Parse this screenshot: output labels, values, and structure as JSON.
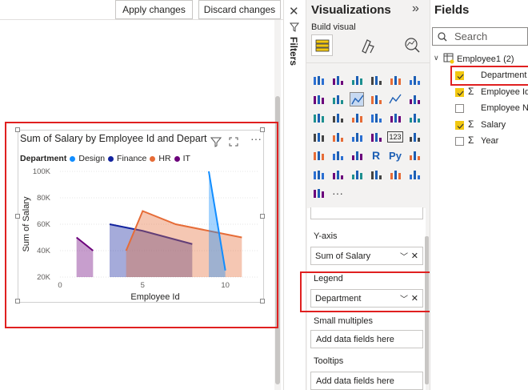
{
  "toolbar": {
    "apply_label": "Apply changes",
    "discard_label": "Discard changes"
  },
  "filters": {
    "label": "Filters"
  },
  "visual": {
    "title": "Sum of Salary by Employee Id and Depart",
    "legend_title": "Department",
    "legend": [
      {
        "name": "Design",
        "color": "#118dff"
      },
      {
        "name": "Finance",
        "color": "#12239e"
      },
      {
        "name": "HR",
        "color": "#e66c37"
      },
      {
        "name": "IT",
        "color": "#6b007b"
      }
    ]
  },
  "chart_data": {
    "type": "area",
    "title": "Sum of Salary by Employee Id and Depart",
    "xlabel": "Employee Id",
    "ylabel": "Sum of Salary",
    "xlim": [
      0,
      12
    ],
    "ylim": [
      20000,
      100000
    ],
    "x_ticks": [
      "0",
      "5",
      "10"
    ],
    "y_ticks": [
      "100K",
      "80K",
      "60K",
      "40K",
      "20K"
    ],
    "series": [
      {
        "name": "Design",
        "color": "#118dff",
        "x": [
          9,
          10
        ],
        "values": [
          100000,
          25000
        ]
      },
      {
        "name": "Finance",
        "color": "#12239e",
        "x": [
          3,
          5,
          8
        ],
        "values": [
          60000,
          55000,
          45000
        ]
      },
      {
        "name": "HR",
        "color": "#e66c37",
        "x": [
          4,
          5,
          7,
          11
        ],
        "values": [
          40000,
          70000,
          60000,
          50000
        ]
      },
      {
        "name": "IT",
        "color": "#6b007b",
        "x": [
          1,
          2
        ],
        "values": [
          50000,
          40000
        ]
      }
    ]
  },
  "visualizations": {
    "title": "Visualizations",
    "expand": "»",
    "build_visual": "Build visual",
    "yaxis_label": "Y-axis",
    "yaxis_field": "Sum of Salary",
    "legend_label": "Legend",
    "legend_field": "Department",
    "small_multiples_label": "Small multiples",
    "small_multiples_placeholder": "Add data fields here",
    "tooltips_label": "Tooltips",
    "tooltips_placeholder": "Add data fields here",
    "more": "···"
  },
  "fields": {
    "title": "Fields",
    "search_placeholder": "Search",
    "table_name": "Employee1 (2)",
    "items": [
      {
        "label": "Department",
        "checked": true,
        "sigma": false
      },
      {
        "label": "Employee Id",
        "checked": true,
        "sigma": true
      },
      {
        "label": "Employee Na",
        "checked": false,
        "sigma": false
      },
      {
        "label": "Salary",
        "checked": true,
        "sigma": true
      },
      {
        "label": "Year",
        "checked": false,
        "sigma": true
      }
    ]
  }
}
